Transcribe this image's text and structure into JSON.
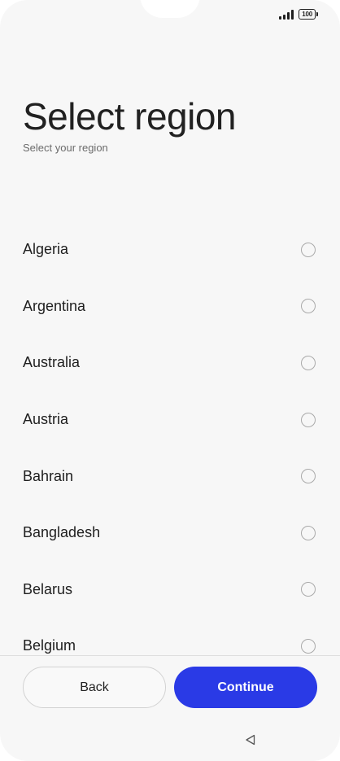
{
  "status_bar": {
    "battery": "100",
    "signal_icon": "signal-bars-icon",
    "battery_icon": "battery-icon"
  },
  "header": {
    "title": "Select region",
    "subtitle": "Select your region"
  },
  "regions": [
    {
      "label": "Algeria",
      "selected": false
    },
    {
      "label": "Argentina",
      "selected": false
    },
    {
      "label": "Australia",
      "selected": false
    },
    {
      "label": "Austria",
      "selected": false
    },
    {
      "label": "Bahrain",
      "selected": false
    },
    {
      "label": "Bangladesh",
      "selected": false
    },
    {
      "label": "Belarus",
      "selected": false
    },
    {
      "label": "Belgium",
      "selected": false
    }
  ],
  "footer": {
    "back_label": "Back",
    "continue_label": "Continue"
  },
  "nav": {
    "back_icon": "triangle-back-icon"
  },
  "colors": {
    "accent": "#2a3ae6",
    "background": "#f7f7f7"
  }
}
